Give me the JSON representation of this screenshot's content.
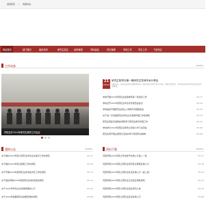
{
  "topbar": {
    "links": [
      "返回首页",
      "|",
      "收藏本站"
    ]
  },
  "nav": {
    "items": [
      "网站首页",
      "部门概况",
      "组织机构",
      "研究生招生",
      "培养管理",
      "学科建设",
      "学位管理",
      "导师工作",
      "学生工作",
      "下载专区"
    ],
    "active_index": 0
  },
  "work_news": {
    "title": "工作动态",
    "more": "MORE+",
    "photo_caption": "学校召开2024年研究生教育工作会议",
    "feature": {
      "day": "21",
      "ym": "2024-05",
      "title": "研究生院举办第一期研究生导师学术分享会",
      "desc": "5月20日，研究生院在行政楼举办第一期研究生导师学术分享会，学校分管领导、各学院研究生导师及研究生代表参加。"
    },
    "items": [
      {
        "title": "学校开展2024年研究生指导教师第一轮培训工作",
        "date": "05-17"
      },
      {
        "title": "学校召开2024年研究生学位评定委员会会议",
        "date": "05-16"
      },
      {
        "title": "学校组织开展研究生新生入学教育专题报告会",
        "date": "05-15"
      },
      {
        "title": "关于进一步加强研究生学位论文质量管理工作的通知",
        "date": "05-13"
      },
      {
        "title": "研究生院赴兄弟院校调研学习研究生教育管理工作",
        "date": "05-10"
      },
      {
        "title": "学校举行2024年研究生导师立德树人学习交流会",
        "date": "05-08"
      },
      {
        "title": "研究生院开展主题党日活动并学习贯彻有关精神",
        "date": "05-06"
      }
    ]
  },
  "notices": {
    "title": "通知公告",
    "more": "MORE+",
    "items": [
      {
        "title": "关于做好2024年硕士研究生学位论文答辩工作的通知",
        "date": "05-17"
      },
      {
        "title": "关于做好2024年复试录取工作的通知",
        "date": "05-16"
      },
      {
        "title": "关于开展2024年度研究生奖学金评定工作的通知",
        "date": "05-14"
      },
      {
        "title": "关于组织申报2024年度研究生创新项目的通知",
        "date": "05-12"
      },
      {
        "title": "关于2024年学位论文送审结果的公示",
        "date": "05-10"
      },
      {
        "title": "关于2024年暑期研究生放假安排的通知",
        "date": "05-08"
      }
    ]
  },
  "downloads": {
    "title": "资料下载",
    "more": "MORE+",
    "items": [
      {
        "title": "河西学院2024年硕士学位授予名单公示第二一批",
        "date": "05-17"
      },
      {
        "title": "河西学院2024年硕士研究生调剂复试录取名单公示",
        "date": "05-16"
      },
      {
        "title": "河西学院2024年硕士研究生复试名单公示（第二批）",
        "date": "05-14"
      },
      {
        "title": "河西学院2024年硕士研究生正式招生录取通知",
        "date": "05-12"
      },
      {
        "title": "河西学院2024年硕士研究生招生调剂公告",
        "date": "05-10"
      },
      {
        "title": "河西学院2024年硕士研究生复试名单公示",
        "date": "05-08"
      }
    ]
  },
  "colors": {
    "accent": "#a3302a",
    "nav_active": "#7e1f1a"
  }
}
